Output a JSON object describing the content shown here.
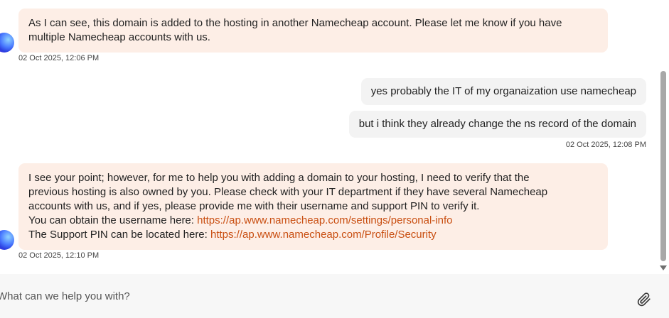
{
  "messages": {
    "agent_1": {
      "lines": [
        "As I can see, this domain is added to the hosting in another Namecheap account. Please let me know if you have",
        "multiple Namecheap accounts with us."
      ],
      "timestamp": "02 Oct 2025, 12:06 PM"
    },
    "user_1": {
      "text": "yes probably the IT of my organaization use namecheap"
    },
    "user_2": {
      "text": "but i think they already change the ns record of the domain"
    },
    "user_timestamp": "02 Oct 2025, 12:08 PM",
    "agent_2": {
      "lines": [
        "I see your point; however, for me to help you with adding a domain to your hosting, I need to verify that the",
        "previous hosting is also owned by you. Please check with your IT department if they have several Namecheap",
        "accounts with us, and if yes, please provide me with their username and support PIN to verify it."
      ],
      "username_prefix": "You can obtain the username here: ",
      "username_link": "https://ap.www.namecheap.com/settings/personal-info",
      "pin_prefix": "The Support PIN can be located here: ",
      "pin_link": "https://ap.www.namecheap.com/Profile/Security",
      "timestamp": "02 Oct 2025, 12:10 PM"
    }
  },
  "composer": {
    "placeholder": "What can we help you with?",
    "value": "",
    "attach_icon": "paperclip-icon"
  },
  "colors": {
    "agent_bubble": "#fdeee6",
    "user_bubble": "#f3f3f3",
    "link": "#c94f12",
    "composer_bg": "#f7f7f7"
  }
}
